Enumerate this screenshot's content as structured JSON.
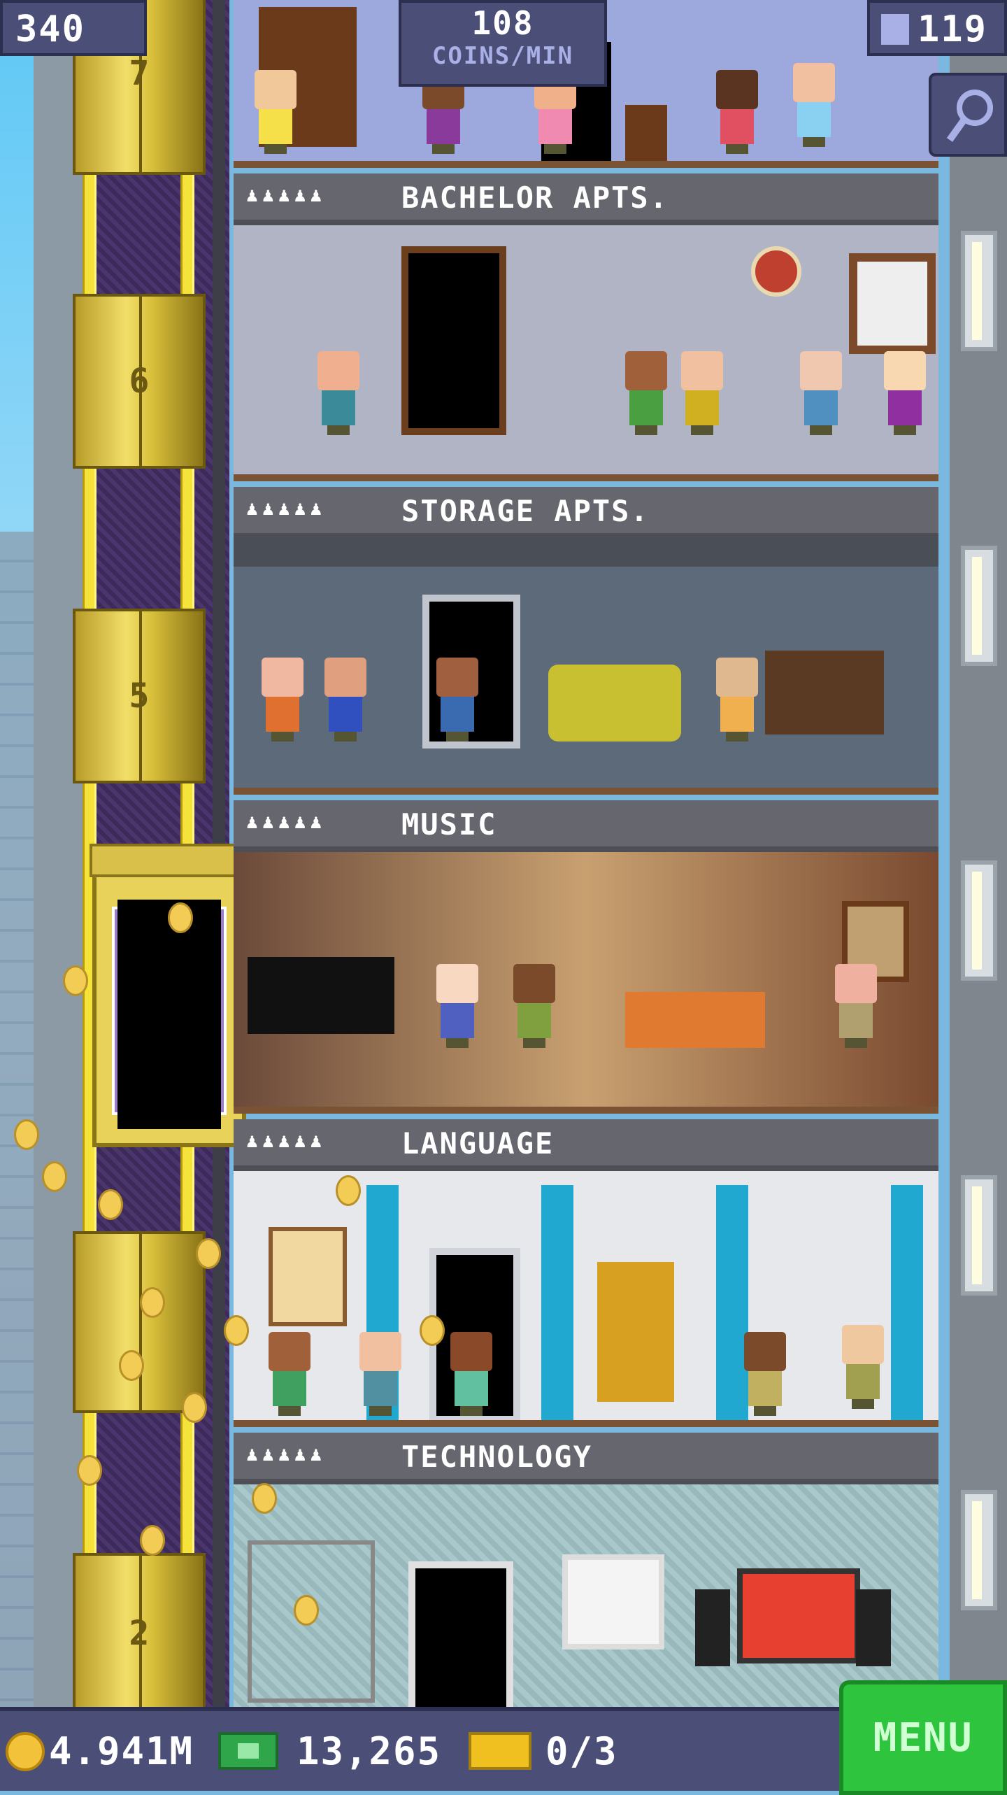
{
  "hud_top": {
    "population": "340",
    "income_value": "108",
    "income_unit": "COINS/MIN",
    "floors_count": "119"
  },
  "floors": [
    {
      "name": "BACHELOR APTS.",
      "residents_icon": "♟♟♟♟♟"
    },
    {
      "name": "STORAGE APTS.",
      "residents_icon": "♟♟♟♟♟"
    },
    {
      "name": "MUSIC",
      "residents_icon": "♟♟♟♟♟"
    },
    {
      "name": "LANGUAGE",
      "residents_icon": "♟♟♟♟♟"
    },
    {
      "name": "TECHNOLOGY",
      "residents_icon": "♟♟♟♟♟"
    }
  ],
  "elevator_floor_numbers": [
    "7",
    "6",
    "5",
    "2"
  ],
  "hud_bottom": {
    "coins": "4.941M",
    "bux": "13,265",
    "tickets": "0/3",
    "menu_label": "MENU"
  },
  "icons": {
    "population": "person-icon",
    "floors": "building-icon",
    "search": "magnifier-icon",
    "coins": "coin-icon",
    "bux": "bux-icon",
    "tickets": "ticket-icon"
  },
  "colors": {
    "hud_bg": "#4b4f78",
    "menu_green": "#2ec43e",
    "label_bar": "#66666e",
    "elevator_gold": "#f2df6a"
  }
}
